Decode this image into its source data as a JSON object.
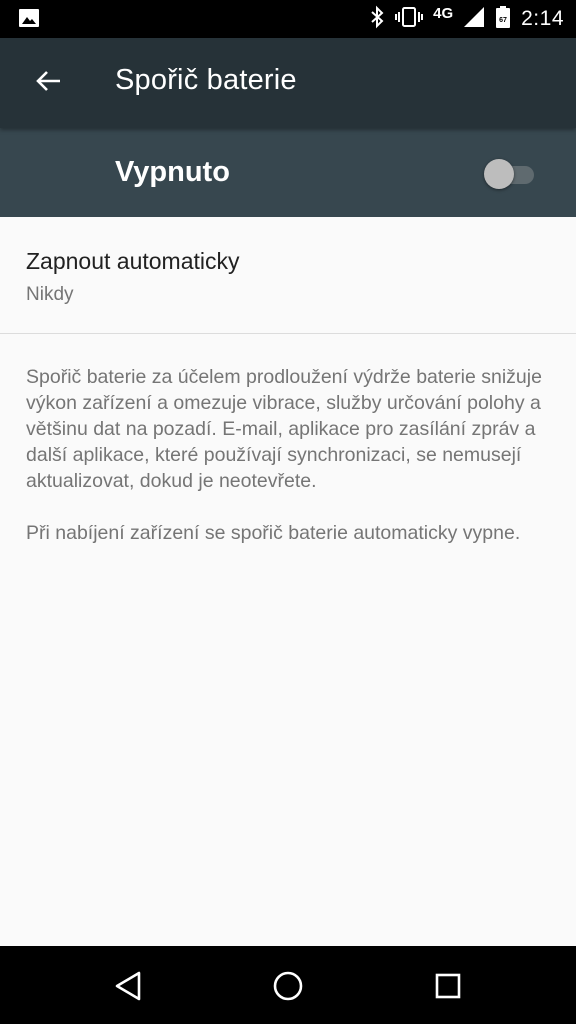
{
  "status_bar": {
    "time": "2:14",
    "network": "4G",
    "battery_level": "67",
    "icons": [
      "image-notification-icon",
      "bluetooth-icon",
      "vibrate-icon",
      "signal-icon",
      "battery-icon"
    ]
  },
  "app_bar": {
    "title": "Spořič baterie",
    "back_icon": "arrow-back-icon"
  },
  "master_switch": {
    "label": "Vypnuto",
    "checked": false
  },
  "preference": {
    "title": "Zapnout automaticky",
    "summary": "Nikdy"
  },
  "info": {
    "paragraph1": "Spořič baterie za účelem prodloužení výdrže baterie snižuje výkon zařízení a omezuje vibrace, služby určování polohy a většinu dat na pozadí. E-mail, aplikace pro zasílání zpráv a další aplikace, které používají synchronizaci, se nemusejí aktualizovat, dokud je neotevřete.",
    "paragraph2": "Při nabíjení zařízení se spořič baterie automaticky vypne."
  },
  "nav_bar": {
    "icons": [
      "nav-back-icon",
      "nav-home-icon",
      "nav-recents-icon"
    ]
  },
  "colors": {
    "app_bar": "#263238",
    "switch_bar": "#37474f",
    "background": "#fafafa",
    "status_bar": "#000000"
  }
}
